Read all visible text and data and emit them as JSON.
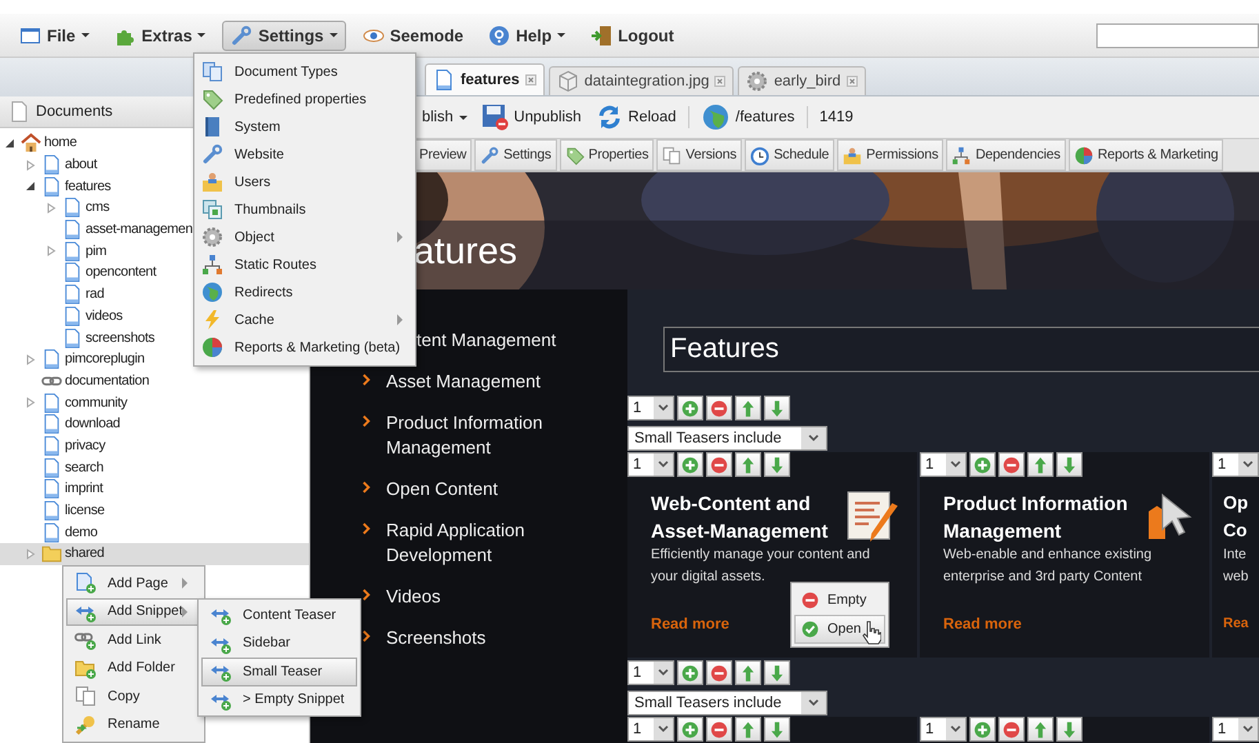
{
  "menubar": [
    {
      "label": "File",
      "has_menu": true,
      "selected": false
    },
    {
      "label": "Extras",
      "has_menu": true,
      "selected": false
    },
    {
      "label": "Settings",
      "has_menu": true,
      "selected": true
    },
    {
      "label": "Seemode",
      "has_menu": false,
      "selected": false
    },
    {
      "label": "Help",
      "has_menu": true,
      "selected": false
    },
    {
      "label": "Logout",
      "has_menu": false,
      "selected": false
    }
  ],
  "settings_menu": [
    {
      "label": "Document Types",
      "has_submenu": false
    },
    {
      "label": "Predefined properties",
      "has_submenu": false
    },
    {
      "label": "System",
      "has_submenu": false
    },
    {
      "label": "Website",
      "has_submenu": false
    },
    {
      "label": "Users",
      "has_submenu": false
    },
    {
      "label": "Thumbnails",
      "has_submenu": false
    },
    {
      "label": "Object",
      "has_submenu": true
    },
    {
      "label": "Static Routes",
      "has_submenu": false
    },
    {
      "label": "Redirects",
      "has_submenu": false
    },
    {
      "label": "Cache",
      "has_submenu": true
    },
    {
      "label": "Reports & Marketing (beta)",
      "has_submenu": false
    }
  ],
  "left_panel": {
    "title": "Documents",
    "tree": [
      {
        "label": "home",
        "kind": "home",
        "expanded": true,
        "selected": false,
        "children": [
          {
            "label": "about",
            "kind": "page",
            "expanded": false,
            "selected": false
          },
          {
            "label": "features",
            "kind": "page",
            "expanded": true,
            "selected": false,
            "children": [
              {
                "label": "cms",
                "kind": "page",
                "expanded": false,
                "selected": false
              },
              {
                "label": "asset-managemen",
                "kind": "page",
                "selected": false
              },
              {
                "label": "pim",
                "kind": "page",
                "expanded": false,
                "selected": false
              },
              {
                "label": "opencontent",
                "kind": "page",
                "selected": false
              },
              {
                "label": "rad",
                "kind": "page",
                "selected": false
              },
              {
                "label": "videos",
                "kind": "page",
                "selected": false
              },
              {
                "label": "screenshots",
                "kind": "page",
                "selected": false
              }
            ]
          },
          {
            "label": "pimcoreplugin",
            "kind": "page",
            "expanded": false,
            "selected": false
          },
          {
            "label": "documentation",
            "kind": "link",
            "selected": false
          },
          {
            "label": "community",
            "kind": "page",
            "expanded": false,
            "selected": false
          },
          {
            "label": "download",
            "kind": "page",
            "selected": false
          },
          {
            "label": "privacy",
            "kind": "page",
            "selected": false
          },
          {
            "label": "search",
            "kind": "page",
            "selected": false
          },
          {
            "label": "imprint",
            "kind": "page",
            "selected": false
          },
          {
            "label": "license",
            "kind": "page",
            "selected": false
          },
          {
            "label": "demo",
            "kind": "page",
            "selected": false
          },
          {
            "label": "shared",
            "kind": "folder",
            "expanded": false,
            "selected": true
          }
        ]
      }
    ]
  },
  "tabs": [
    {
      "label": "features",
      "selected": true
    },
    {
      "label": "dataintegration.jpg",
      "selected": false
    },
    {
      "label": "early_bird",
      "selected": false
    }
  ],
  "toolbar": {
    "publish": "blish",
    "unpublish": "Unpublish",
    "reload": "Reload",
    "path": "/features",
    "id": "1419"
  },
  "subtabs": [
    {
      "label": "Preview",
      "selected": false
    },
    {
      "label": "Settings",
      "selected": false
    },
    {
      "label": "Properties",
      "selected": false
    },
    {
      "label": "Versions",
      "selected": false
    },
    {
      "label": "Schedule",
      "selected": false
    },
    {
      "label": "Permissions",
      "selected": false
    },
    {
      "label": "Dependencies",
      "selected": false
    },
    {
      "label": "Reports & Marketing",
      "selected": false
    }
  ],
  "page": {
    "heading": "atures",
    "nav": [
      "tent Management",
      "Asset Management",
      "Product Information Management",
      "Open Content",
      "Rapid Application Development",
      "Videos",
      "Screenshots"
    ],
    "title_field": "Features",
    "blocks": [
      {
        "index": "1",
        "include": "Small Teasers include",
        "teasers": [
          {
            "index": "1",
            "title_lines": [
              "Web-Content and",
              "Asset-Management"
            ],
            "text_lines": [
              "Efficiently manage your content and",
              "your digital assets."
            ],
            "link": "Read more"
          },
          {
            "index": "1",
            "title_lines": [
              "Product Information",
              "Management"
            ],
            "text_lines": [
              "Web-enable and enhance existing",
              "enterprise and 3rd party Content"
            ],
            "link": "Read more"
          },
          {
            "index": "1",
            "title_lines": [
              "Op",
              "Co"
            ],
            "text_lines": [
              "Inte",
              "web"
            ],
            "link": "Rea"
          }
        ]
      },
      {
        "index": "1",
        "include": "Small Teasers include",
        "teasers": [
          {
            "index": "1"
          },
          {
            "index": "1"
          },
          {
            "index": "1"
          }
        ]
      }
    ]
  },
  "teaser_popup": [
    {
      "label": "Empty",
      "kind": "empty",
      "selected": false
    },
    {
      "label": "Open",
      "kind": "open",
      "selected": true
    }
  ],
  "context_menu": [
    {
      "label": "Add Page",
      "has_submenu": true,
      "selected": false
    },
    {
      "label": "Add Snippet",
      "has_submenu": true,
      "selected": true
    },
    {
      "label": "Add Link",
      "has_submenu": false,
      "selected": false
    },
    {
      "label": "Add Folder",
      "has_submenu": false,
      "selected": false
    },
    {
      "label": "Copy",
      "has_submenu": false,
      "selected": false
    },
    {
      "label": "Rename",
      "has_submenu": false,
      "selected": false
    }
  ],
  "snippet_submenu": [
    {
      "label": "Content Teaser",
      "selected": false
    },
    {
      "label": "Sidebar",
      "selected": false
    },
    {
      "label": "Small Teaser",
      "selected": true
    },
    {
      "label": "> Empty Snippet",
      "selected": false
    }
  ]
}
